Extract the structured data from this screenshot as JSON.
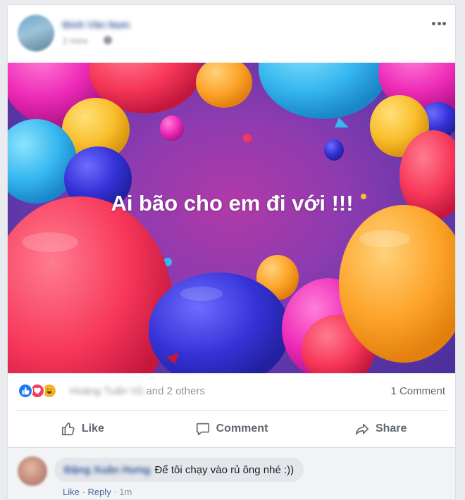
{
  "post": {
    "author_name": "Đinh Văn Nam",
    "time": "2 mins",
    "image_text": "Ai bão cho em đi với !!!"
  },
  "reactions": {
    "names_blurred": "Hoàng Tuấn Vũ",
    "names_suffix": "and 2 others",
    "icons": [
      "like-icon",
      "love-icon",
      "haha-icon"
    ],
    "comment_count": "1 Comment"
  },
  "actions": {
    "like": "Like",
    "comment": "Comment",
    "share": "Share"
  },
  "comment": {
    "author": "Đặng Xuân Hưng",
    "text": "Để tôi chạy vào rủ ông nhé :))",
    "like": "Like",
    "reply": "Reply",
    "time": "1m",
    "separator": "·"
  },
  "colors": {
    "link_blue": "#385898",
    "like_blue": "#2078f4",
    "love_red": "#f33e58",
    "haha_yellow": "#f7b125"
  }
}
